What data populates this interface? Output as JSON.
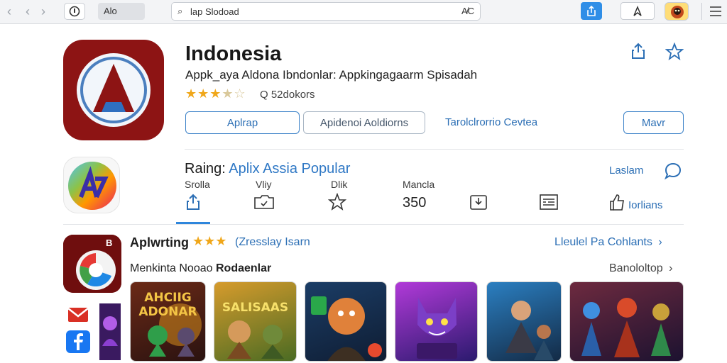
{
  "browser": {
    "tab_label": "Alo",
    "url_text": "lap Slodoad",
    "url_right": "A̸C",
    "icons": [
      "back-icon",
      "forward-icon",
      "info-icon",
      "search-icon",
      "share-icon",
      "bookmark-icon",
      "menu-icon"
    ]
  },
  "app": {
    "title": "Indonesia",
    "subtitle": "Appk_aya Aldona Ibndonlar: Appkingagaarm Spisadah",
    "stars_filled": 3,
    "stars_half": 1,
    "stars_total": 5,
    "rating_count": "Q 52dokors",
    "buttons": {
      "primary": "Aplrap",
      "secondary": "Apidenoi Aoldiorns",
      "link": "Tarolclrorrio Cevtea",
      "more": "Mavr"
    },
    "brand_color": "#8d1414",
    "accent_color": "#2c6fb5"
  },
  "rating_row": {
    "title_prefix": "Raing:",
    "title_highlight": "Aplix Assia Popular",
    "laslam": "Laslam",
    "stats": [
      {
        "label": "Srolla",
        "icon": "share-icon"
      },
      {
        "label": "Vliy",
        "icon": "folder-icon"
      },
      {
        "label": "Dlik",
        "icon": "star-outline-icon"
      },
      {
        "label": "Mancla",
        "value": "350"
      },
      {
        "icon": "download-box-icon"
      },
      {
        "icon": "list-icon"
      },
      {
        "icon": "thumb-up-icon",
        "label": "Iorlians"
      }
    ]
  },
  "apps_section": {
    "title": "Aplwrting",
    "stars": "★★★",
    "link": "(Zresslay Isarn",
    "see_all": "Lleulel Pa Cohlants",
    "subtitle_prefix": "Menkinta",
    "subtitle_middle": "Nooao",
    "subtitle_bold": "Rodaenlar",
    "subtitle_link": "Banololtop",
    "thumbnails": [
      {
        "caption": "AHCIIG ADONAR",
        "bg": "#3b1b14"
      },
      {
        "caption": "SALISAAS",
        "bg": "#6f4a18"
      },
      {
        "caption": "",
        "bg": "#1c3553"
      },
      {
        "caption": "",
        "bg": "#5a1f86"
      },
      {
        "caption": "",
        "bg": "#1e4f78"
      },
      {
        "caption": "",
        "bg": "#4b1f2f"
      }
    ]
  }
}
